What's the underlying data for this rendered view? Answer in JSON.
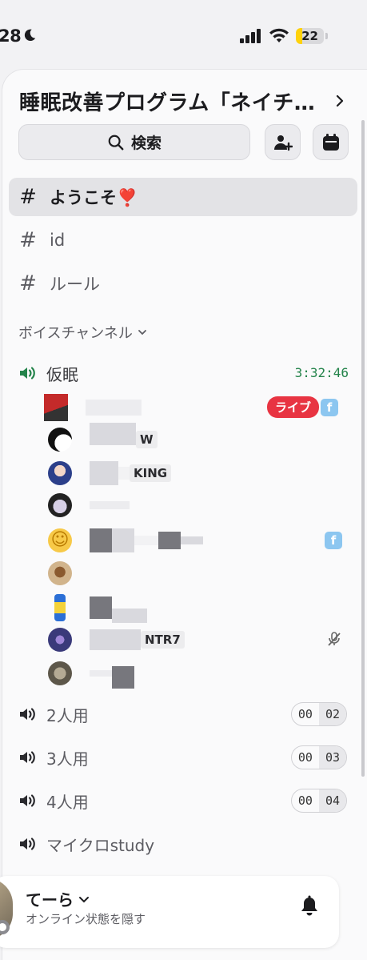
{
  "status_bar": {
    "time": "28",
    "battery_level": 22,
    "battery_label": "22",
    "icons": [
      "moon-icon",
      "signal-icon",
      "wifi-icon",
      "battery-icon"
    ]
  },
  "server": {
    "title": "睡眠改善プログラム「ネイチ…"
  },
  "toolbar": {
    "search_label": "検索",
    "icons": [
      "search-icon",
      "add-member-icon",
      "calendar-icon"
    ]
  },
  "text_channels": [
    {
      "label": "ようこそ❣️",
      "selected": true
    },
    {
      "label": "id",
      "selected": false
    },
    {
      "label": "ルール",
      "selected": false
    }
  ],
  "voice_category": {
    "label": "ボイスチャンネル"
  },
  "active_voice": {
    "label": "仮眠",
    "timer": "3:32:46",
    "live_badge": "ライブ",
    "members": [
      {
        "visible_name": "",
        "badges": [
          "live",
          "f"
        ]
      },
      {
        "visible_name": "W",
        "badges": []
      },
      {
        "visible_name": "KING",
        "badges": []
      },
      {
        "visible_name": "",
        "badges": []
      },
      {
        "visible_name": "",
        "badges": [
          "f"
        ]
      },
      {
        "visible_name": "",
        "badges": []
      },
      {
        "visible_name": "",
        "badges": []
      },
      {
        "visible_name": "NTR7",
        "badges": [
          "muted"
        ]
      },
      {
        "visible_name": "",
        "badges": []
      }
    ],
    "fb_badge_letter": "f"
  },
  "voice_channels": [
    {
      "label": "2人用",
      "count": "00",
      "limit": "02"
    },
    {
      "label": "3人用",
      "count": "00",
      "limit": "03"
    },
    {
      "label": "4人用",
      "count": "00",
      "limit": "04"
    },
    {
      "label": "マイクロstudy",
      "count": "",
      "limit": ""
    }
  ],
  "user_bar": {
    "name": "てーら",
    "status_text": "オンライン状態を隠す"
  },
  "colors": {
    "accent_green": "#23834a",
    "live_red": "#e83442",
    "battery_yellow": "#ffd20a"
  }
}
